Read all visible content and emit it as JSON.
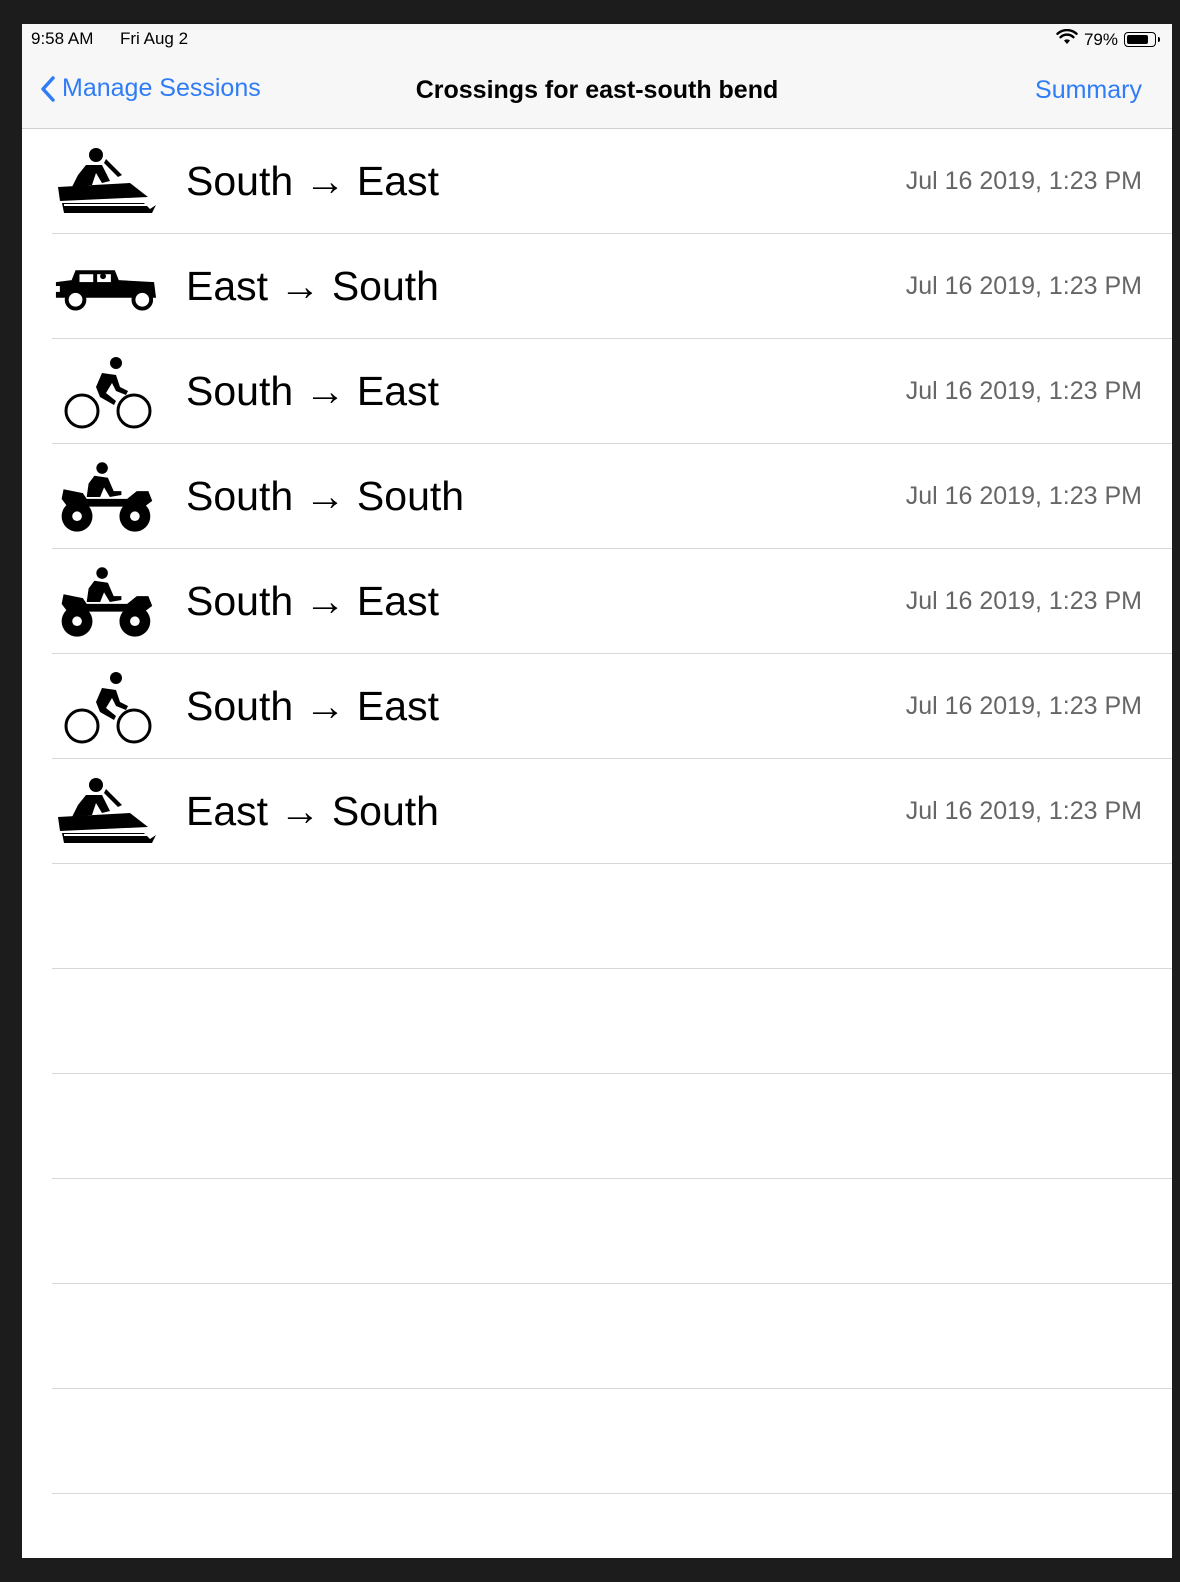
{
  "status_bar": {
    "time": "9:58 AM",
    "date": "Fri Aug 2",
    "battery_percent": "79%",
    "battery_level": 0.79
  },
  "nav": {
    "back_label": "Manage Sessions",
    "title": "Crossings for east-south bend",
    "summary_label": "Summary"
  },
  "crossings": [
    {
      "vehicle": "snowmobile-icon",
      "route": "South → East",
      "time": "Jul 16 2019, 1:23 PM"
    },
    {
      "vehicle": "jeep-icon",
      "route": "East → South",
      "time": "Jul 16 2019, 1:23 PM"
    },
    {
      "vehicle": "bicycle-icon",
      "route": "South → East",
      "time": "Jul 16 2019, 1:23 PM"
    },
    {
      "vehicle": "atv-icon",
      "route": "South → South",
      "time": "Jul 16 2019, 1:23 PM"
    },
    {
      "vehicle": "atv-icon",
      "route": "South → East",
      "time": "Jul 16 2019, 1:23 PM"
    },
    {
      "vehicle": "bicycle-icon",
      "route": "South → East",
      "time": "Jul 16 2019, 1:23 PM"
    },
    {
      "vehicle": "snowmobile-icon",
      "route": "East → South",
      "time": "Jul 16 2019, 1:23 PM"
    }
  ],
  "colors": {
    "accent": "#2f7cf6",
    "separator": "#d8d8dc",
    "secondary_text": "#666666"
  }
}
